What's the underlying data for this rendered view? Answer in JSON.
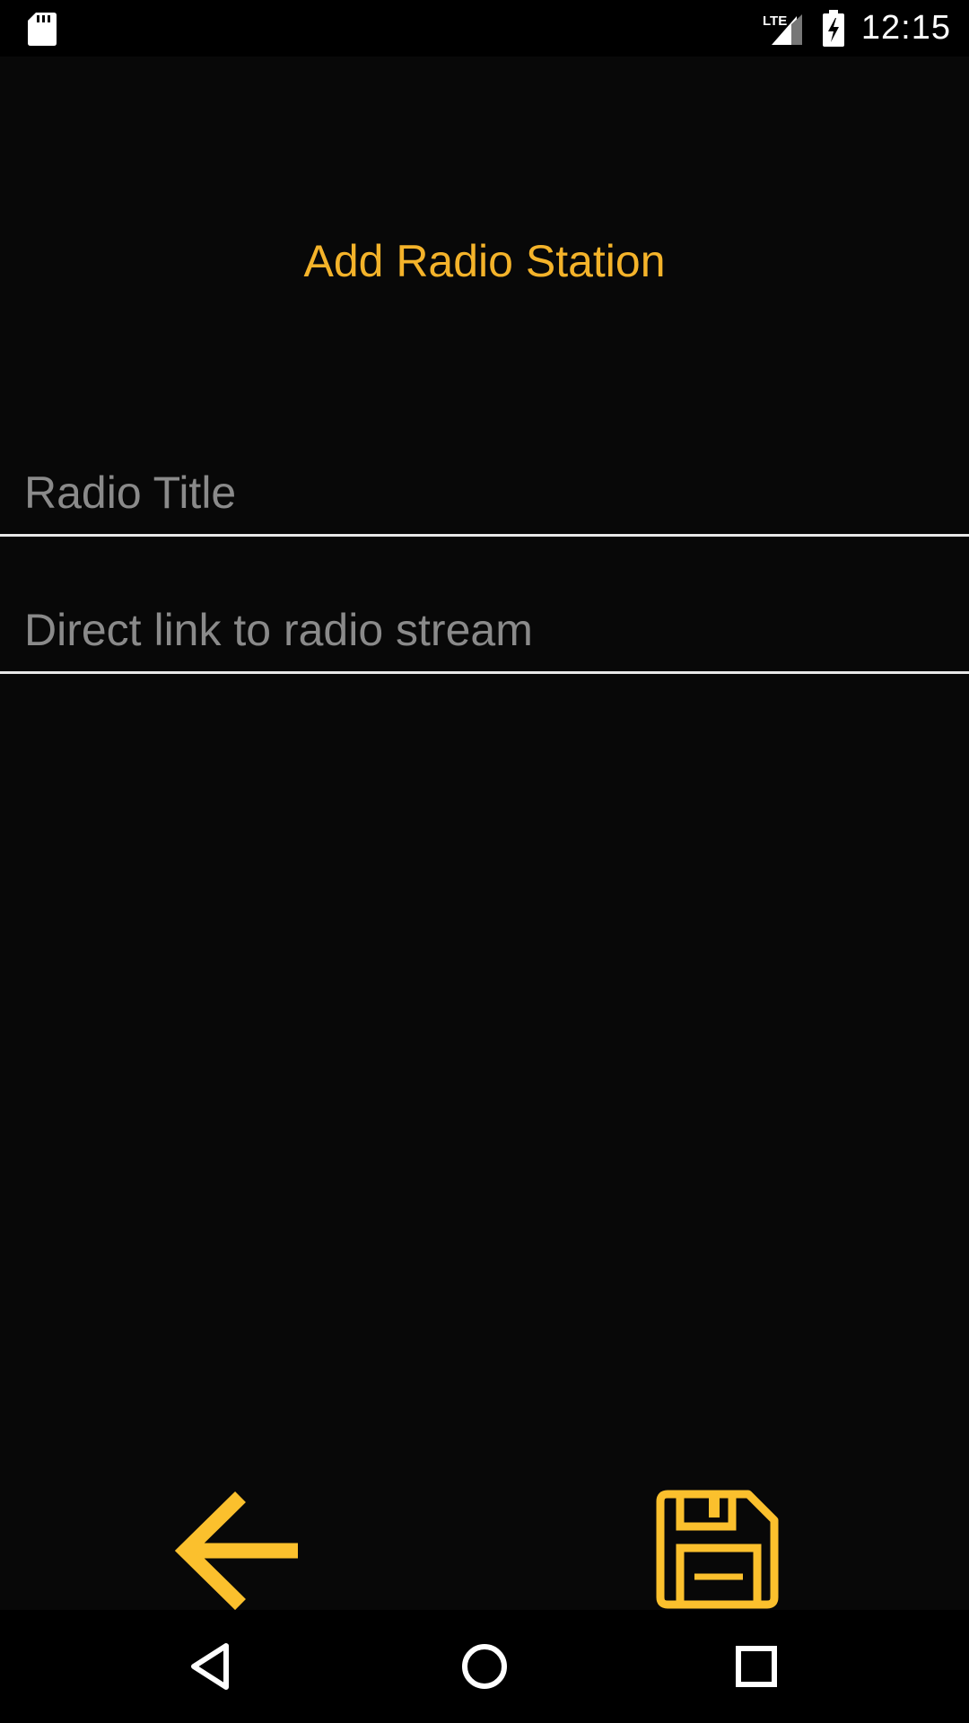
{
  "status_bar": {
    "time": "12:15",
    "network_label": "LTE",
    "icons": [
      "sd-card-icon",
      "signal-icon",
      "battery-charging-icon"
    ]
  },
  "page": {
    "title": "Add Radio Station"
  },
  "form": {
    "title_field": {
      "value": "",
      "placeholder": "Radio Title"
    },
    "link_field": {
      "value": "",
      "placeholder": "Direct link to radio stream"
    }
  },
  "actions": {
    "back_icon": "arrow-left-icon",
    "save_icon": "floppy-disk-icon"
  },
  "colors": {
    "accent": "#f4b32a",
    "icon_accent": "#fbc02d",
    "background": "#080808",
    "placeholder": "#8a8a8a",
    "underline": "#e8e8e8"
  },
  "nav_bar": {
    "icons": [
      "nav-back-icon",
      "nav-home-icon",
      "nav-recents-icon"
    ]
  }
}
